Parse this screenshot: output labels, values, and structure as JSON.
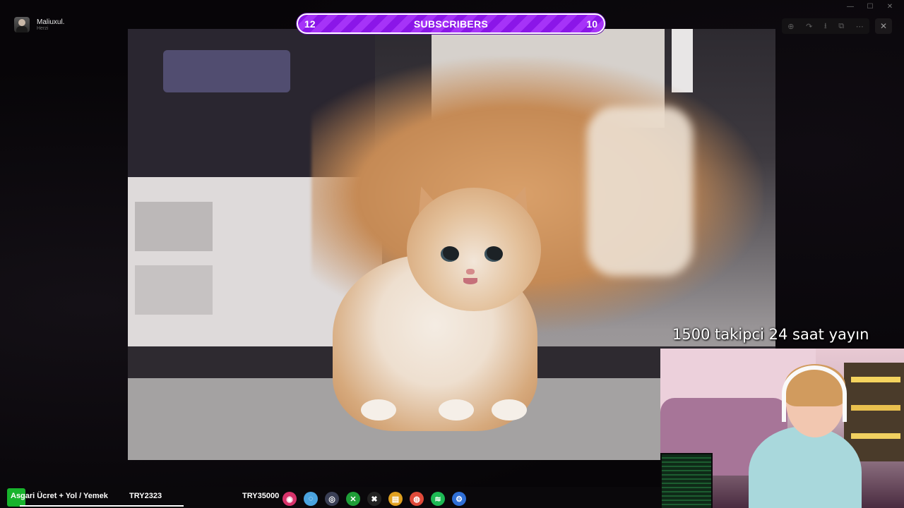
{
  "user": {
    "name": "Maliuxul.",
    "subtitle": "Herzi"
  },
  "window_controls": {
    "minimize": "—",
    "maximize": "☐",
    "close": "✕"
  },
  "viewer_toolbar": {
    "icons": [
      "zoom-icon",
      "rotate-icon",
      "download-icon",
      "open-external-icon",
      "more-icon"
    ],
    "glyphs": [
      "⊕",
      "↷",
      "⭳",
      "⧉",
      "⋯"
    ],
    "close_glyph": "✕"
  },
  "subscribers_bar": {
    "left_value": "12",
    "title": "SUBSCRIBERS",
    "right_value": "10"
  },
  "overlay": {
    "goal_text": "1500 takipci 24 saat yayın"
  },
  "taskbar": {
    "item1": "Asgari Ücret + Yol / Yemek",
    "item2": "TRY2323",
    "item3": "TRY35000",
    "icons": [
      {
        "name": "app-icon",
        "glyph": "◉",
        "color": "#d7336b"
      },
      {
        "name": "edge-icon",
        "glyph": "◌",
        "color": "#4aa3df"
      },
      {
        "name": "steam-icon",
        "glyph": "◎",
        "color": "#3a3f55"
      },
      {
        "name": "xbox-icon",
        "glyph": "✕",
        "color": "#1e9e37"
      },
      {
        "name": "capcut-icon",
        "glyph": "✖",
        "color": "#222222"
      },
      {
        "name": "file-icon",
        "glyph": "▤",
        "color": "#e0a020"
      },
      {
        "name": "chrome-icon",
        "glyph": "◍",
        "color": "#e04a3a"
      },
      {
        "name": "spotify-icon",
        "glyph": "≋",
        "color": "#1db954"
      },
      {
        "name": "settings-icon",
        "glyph": "⚙",
        "color": "#2f6fd6"
      }
    ]
  }
}
